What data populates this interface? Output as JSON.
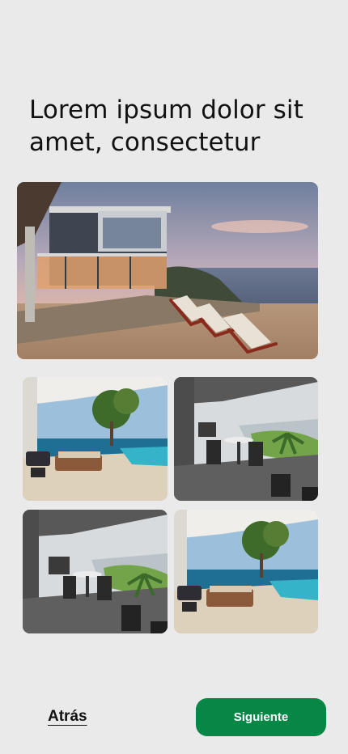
{
  "page": {
    "title": "Lorem ipsum dolor sit amet, consectetur"
  },
  "gallery": {
    "hero": {
      "subject": "modern glass house on cliff at sunset with wooden lounge chairs"
    },
    "tiles": [
      {
        "subject": "covered terrace with sofas and infinity pool overlooking sea"
      },
      {
        "subject": "balcony with round table, chairs and palm plant facing beach"
      },
      {
        "subject": "balcony with grill, table and plant facing beach"
      },
      {
        "subject": "terrace with pool, sofas and tree overlooking sea"
      }
    ]
  },
  "footer": {
    "back_label": "Atrás",
    "next_label": "Siguiente"
  },
  "colors": {
    "background": "#eaeaea",
    "primary_button": "#078746"
  }
}
